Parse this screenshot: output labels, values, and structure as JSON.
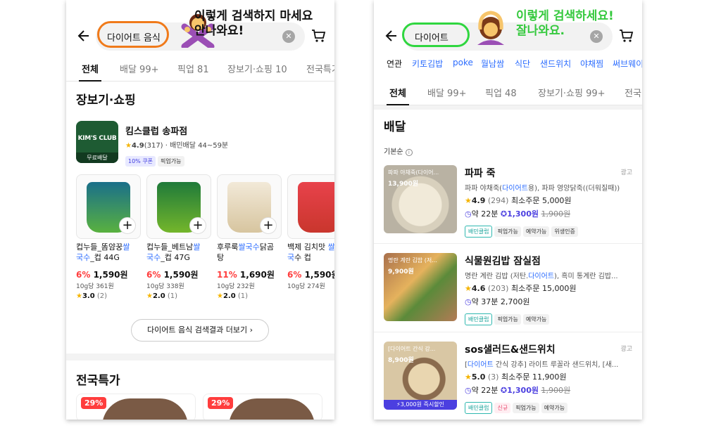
{
  "annotations": {
    "left_note_line1": "이렇게 검색하지 마세요",
    "left_note_line2": "안나와요!",
    "right_note_line1": "이렇게 검색하세요!",
    "right_note_line2": "잘나와요."
  },
  "left_screen": {
    "search_value": "다이어트 음식",
    "tabs": [
      {
        "label": "전체"
      },
      {
        "label": "배달 99+"
      },
      {
        "label": "픽업 81"
      },
      {
        "label": "장보기·쇼핑 10"
      },
      {
        "label": "전국특가"
      }
    ],
    "section_title": "장보기·쇼핑",
    "store": {
      "logo_text": "KIM'S CLUB",
      "logo_badge": "무료배달",
      "name": "킴스클럽 송파점",
      "rating": "4.9",
      "reviews": "(317)",
      "delivery": "· 배민배달 44~59분",
      "coupon": "10% 쿠폰",
      "pickup": "픽업가능"
    },
    "products": [
      {
        "name_a": "컵누들_똠얌꿍",
        "name_hl": "쌀",
        "name_b": "국수",
        "name_c": "_컵 44G",
        "discount": "6%",
        "price": "1,590원",
        "unit": "10g당 361원",
        "rating": "3.0",
        "reviews": "(2)"
      },
      {
        "name_a": "컵누들_베트남",
        "name_hl": "쌀",
        "name_b": "국수",
        "name_c": "_컵 47G",
        "discount": "6%",
        "price": "1,590원",
        "unit": "10g당 338원",
        "rating": "2.0",
        "reviews": "(1)"
      },
      {
        "name_a": "후루룩",
        "name_hl": "쌀국수",
        "name_b": "닭곰",
        "name_c": "탕",
        "discount": "11%",
        "price": "1,690원",
        "unit": "10g당 232원",
        "rating": "2.0",
        "reviews": "(1)"
      },
      {
        "name_a": "백제 김치맛 ",
        "name_hl": "쌀",
        "name_b": "국",
        "name_c": "수 컵",
        "discount": "6%",
        "price": "1,590원",
        "unit": "10g당 274원",
        "rating": "",
        "reviews": ""
      }
    ],
    "more_button": "다이어트 음식 검색결과 더보기",
    "more_chevron": "›",
    "deals_title": "전국특가",
    "deals": [
      {
        "badge": "29%"
      },
      {
        "badge": "29%"
      }
    ]
  },
  "right_screen": {
    "search_value": "다이어트",
    "related_label": "연관",
    "related": [
      "키토김밥",
      "poke",
      "월남쌈",
      "식단",
      "샌드위치",
      "야채찜",
      "써브웨이"
    ],
    "tabs": [
      {
        "label": "전체"
      },
      {
        "label": "배달 99+"
      },
      {
        "label": "픽업 48"
      },
      {
        "label": "장보기·쇼핑 99+"
      },
      {
        "label": "전국"
      }
    ],
    "section_title": "배달",
    "sort_label": "기본순",
    "shops": [
      {
        "img_caption": "파파 야채죽(다이어...",
        "img_price": "13,900원",
        "name": "파파 죽",
        "ad": "광고",
        "desc_a": "파파 야채죽(",
        "desc_hl": "다이어트",
        "desc_b": "용), 파파 영양닭죽((더워질때))",
        "rating": "4.9",
        "reviews": "(294)",
        "min_order": "최소주문 5,000원",
        "time": "약 22분",
        "fee": "1,300원",
        "fee_old": "1,900원",
        "chips": [
          "배민클럽",
          "픽업가능",
          "예약가능",
          "위생인증"
        ],
        "instant": ""
      },
      {
        "img_caption": "명란 계란 김밥 (저...",
        "img_price": "9,900원",
        "name": "식물원김밥 잠실점",
        "ad": "",
        "desc_a": "명란 계란 김밥 (저탄.",
        "desc_hl": "다이어트",
        "desc_b": "), 흑미 통계란 김밥...",
        "rating": "4.6",
        "reviews": "(203)",
        "min_order": "최소주문 15,000원",
        "time": "약 37분",
        "fee": "2,700원",
        "fee_old": "",
        "chips": [
          "배민클럽",
          "픽업가능",
          "예약가능"
        ],
        "instant": ""
      },
      {
        "img_caption": "[다이어트 간식 강...",
        "img_price": "8,900원",
        "name": "sos샐러드&샌드위치",
        "ad": "광고",
        "desc_a": "[",
        "desc_hl": "다이어트",
        "desc_b": " 간식 강추] 라이트 루꼴라 샌드위치, [새...",
        "rating": "5.0",
        "reviews": "(3)",
        "min_order": "최소주문 11,900원",
        "time": "약 22분",
        "fee": "1,300원",
        "fee_old": "1,900원",
        "chips": [
          "배민클럽",
          "신규",
          "픽업가능",
          "예약가능"
        ],
        "instant": "3,000원 즉시할인"
      }
    ]
  },
  "colors": {
    "orange_highlight": "#f07a1a",
    "green_highlight": "#2fd63f",
    "discount_red": "#ff3d3d",
    "link_blue": "#2b6cff",
    "club_purple": "#4b3fe0"
  }
}
